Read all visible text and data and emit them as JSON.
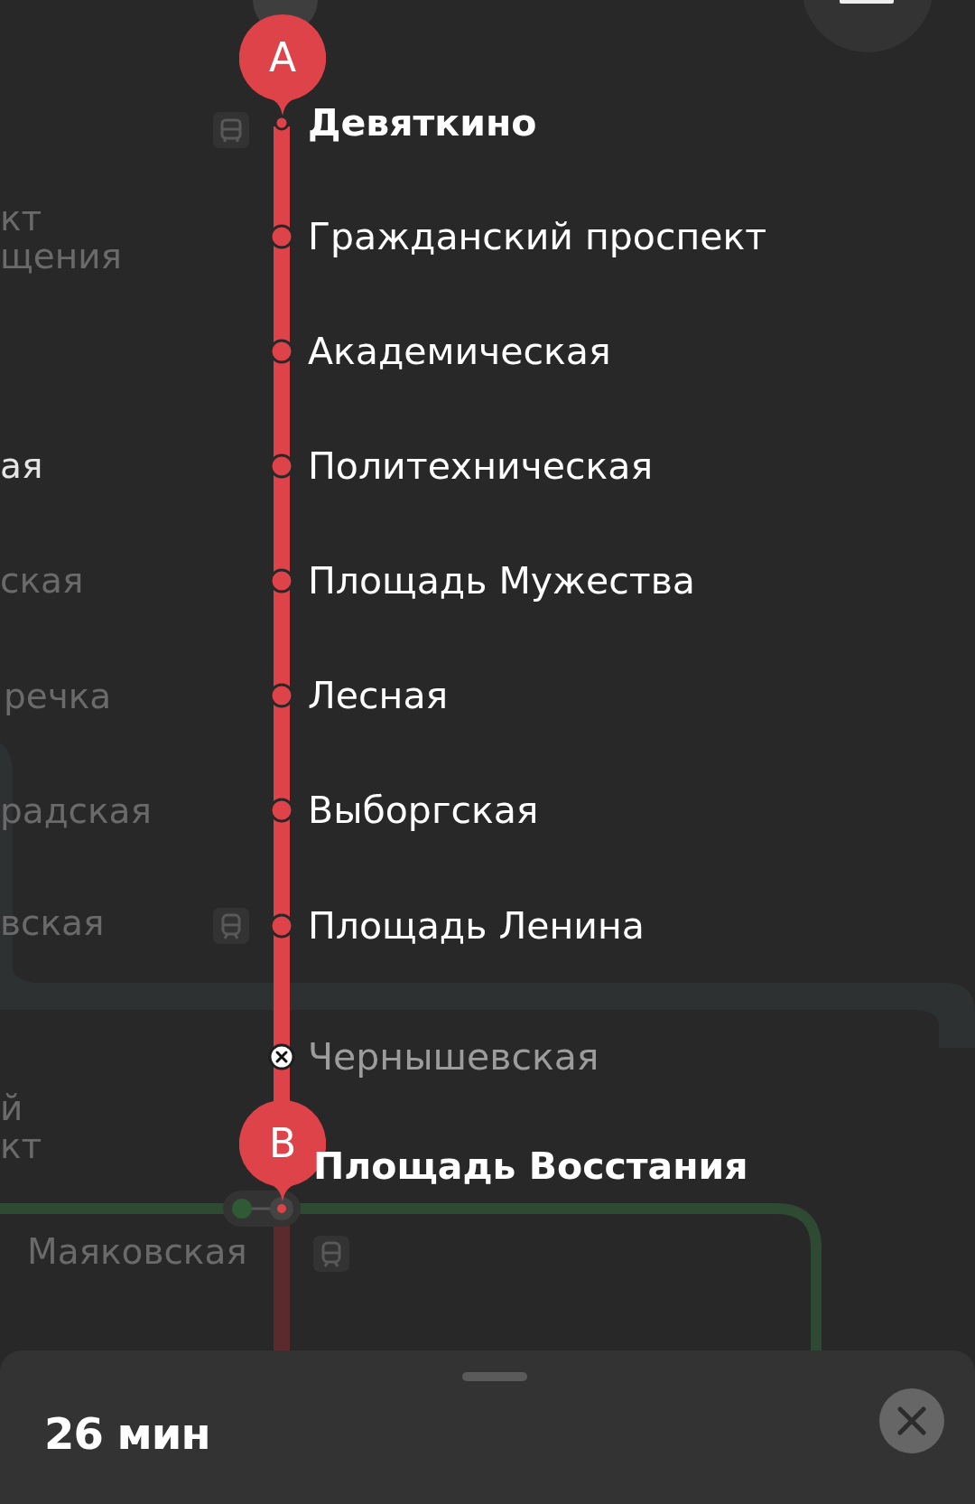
{
  "map": {
    "stations": [
      {
        "name": "Девяткино",
        "kind": "start",
        "marker": "A"
      },
      {
        "name": "Гражданский проспект",
        "kind": "stop"
      },
      {
        "name": "Академическая",
        "kind": "stop"
      },
      {
        "name": "Политехническая",
        "kind": "stop"
      },
      {
        "name": "Площадь Мужества",
        "kind": "stop"
      },
      {
        "name": "Лесная",
        "kind": "stop"
      },
      {
        "name": "Выборгская",
        "kind": "stop"
      },
      {
        "name": "Площадь Ленина",
        "kind": "stop"
      },
      {
        "name": "Чернышевская",
        "kind": "closed"
      },
      {
        "name": "Площадь Восстания",
        "kind": "end",
        "marker": "B"
      }
    ],
    "other_labels": [
      {
        "text": "кт",
        "highlighted": false
      },
      {
        "text": "щения",
        "highlighted": false
      },
      {
        "text": "ая",
        "highlighted": true
      },
      {
        "text": "ская",
        "highlighted": false
      },
      {
        "text": "речка",
        "highlighted": false
      },
      {
        "text": "радская",
        "highlighted": false
      },
      {
        "text": "вская",
        "highlighted": false
      },
      {
        "text": "й",
        "highlighted": false
      },
      {
        "text": "кт",
        "highlighted": false
      },
      {
        "text": "Маяковская",
        "highlighted": false
      }
    ]
  },
  "sheet": {
    "duration": "26 мин"
  }
}
